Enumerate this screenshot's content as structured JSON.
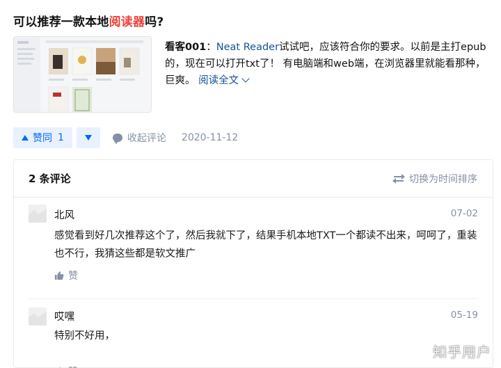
{
  "question": {
    "title_prefix": "可以推荐一款本地",
    "title_highlight": "阅读器",
    "title_suffix": "吗?"
  },
  "answer": {
    "author": "看客001",
    "separator": "：",
    "link_text": "Neat Reader",
    "excerpt": "试试吧，应该符合你的要求。以前是主打epub的，现在可以打开txt了！ 有电脑端和web端，在浏览器里就能看那种，巨爽。",
    "read_more": "阅读全文",
    "thumbnail_alt": "Neat Reader 书架截图"
  },
  "actions": {
    "upvote_label": "赞同",
    "upvote_count": "1",
    "collapse_comments": "收起评论",
    "date": "2020-11-12"
  },
  "comments": {
    "count_label": "2 条评论",
    "sort_label": "切换为时间排序",
    "items": [
      {
        "name": "北风",
        "time": "07-02",
        "body": "感觉看到好几次推荐这个了，然后我就下了，结果手机本地TXT一个都读不出来，呵呵了，重装也不行，我猜这些都是软文推广",
        "like_label": "赞"
      },
      {
        "name": "哎嘿",
        "time": "05-19",
        "body": "特别不好用，",
        "like_label": "赞"
      }
    ]
  },
  "watermark": "知乎用户",
  "colors": {
    "accent_blue": "#0066ff",
    "highlight_red": "#f1403c",
    "link_blue": "#175199",
    "muted_gray": "#8590a6"
  }
}
